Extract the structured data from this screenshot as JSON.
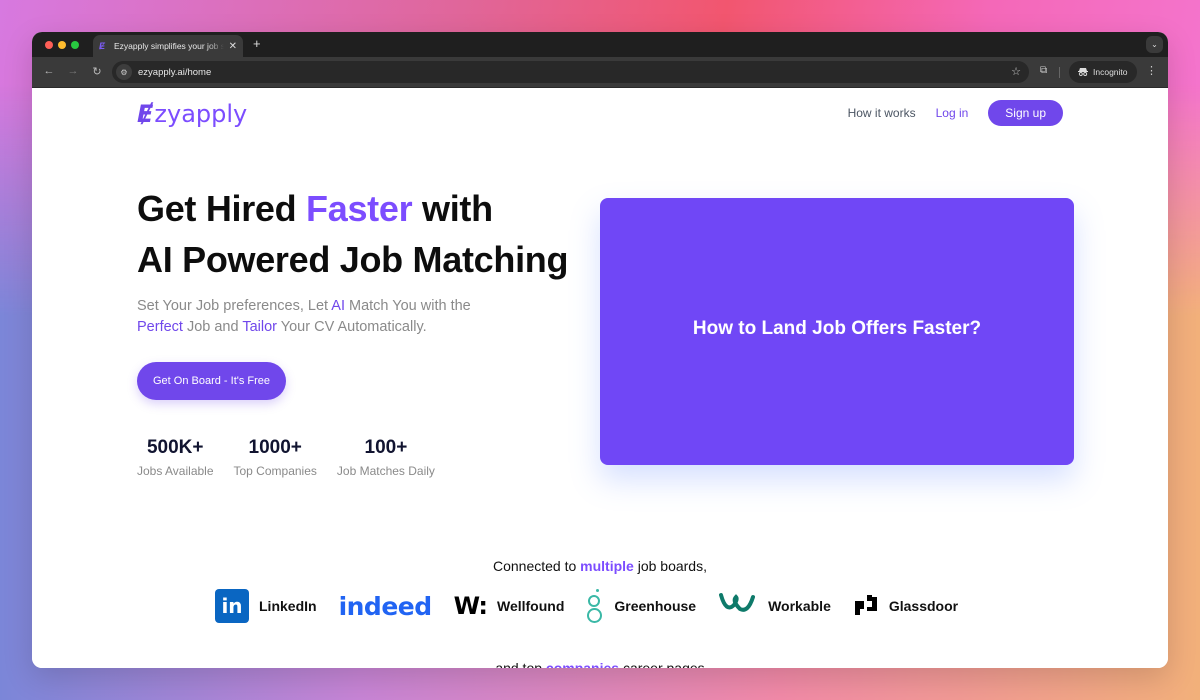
{
  "browser": {
    "tab_title": "Ezyapply simplifies your job search",
    "tab_favicon": "ezyapply-favicon",
    "url": "ezyapply.ai/home",
    "profile_label": "Incognito",
    "icons": {
      "back": "←",
      "forward": "→",
      "reload": "↻",
      "site_info": "⚙",
      "bookmark": "☆",
      "extensions": "⧉",
      "menu": "⋮",
      "close_tab": "✕",
      "new_tab": "+",
      "tab_search": "⌄",
      "incognito": "🕶"
    }
  },
  "header": {
    "logo_mark": "Ɇ",
    "logo_text": "zyapply",
    "nav": {
      "how_it_works": "How it works",
      "login": "Log in",
      "signup": "Sign up"
    }
  },
  "hero": {
    "title_line1_pre": "Get Hired ",
    "title_line1_accent": "Faster",
    "title_line1_post": " with",
    "title_line2": "AI Powered Job Matching",
    "subtitle": {
      "p1": "Set Your Job preferences, Let ",
      "hl1": "AI",
      "p2": " Match You with the ",
      "hl2": "Perfect",
      "p3": " Job and ",
      "hl3": "Tailor",
      "p4": " Your CV Automatically."
    },
    "cta_label": "Get On Board - It's Free",
    "stats": [
      {
        "value": "500K+",
        "label": "Jobs Available"
      },
      {
        "value": "1000+",
        "label": "Top Companies"
      },
      {
        "value": "100+",
        "label": "Job Matches Daily"
      }
    ]
  },
  "video_card": {
    "title": "How to Land Job Offers Faster?"
  },
  "boards_section": {
    "pre": "Connected to ",
    "highlight": "multiple",
    "post": " job boards,",
    "boards": [
      {
        "name": "LinkedIn",
        "icon": "in"
      },
      {
        "name": "indeed",
        "icon": "indeed-logo"
      },
      {
        "name": "Wellfound",
        "icon": "W:"
      },
      {
        "name": "Greenhouse",
        "icon": "greenhouse-logo"
      },
      {
        "name": "Workable",
        "icon": "w"
      },
      {
        "name": "Glassdoor",
        "icon": "glassdoor-logo"
      }
    ],
    "next_pre": "and top ",
    "next_highlight": "companies",
    "next_post": " career pages"
  },
  "colors": {
    "brand": "#7047eb",
    "video_bg": "#7047f6",
    "linkedin": "#0a66c2",
    "indeed": "#2164f3",
    "greenhouse": "#3ab8a6",
    "workable": "#0e7a6a"
  }
}
